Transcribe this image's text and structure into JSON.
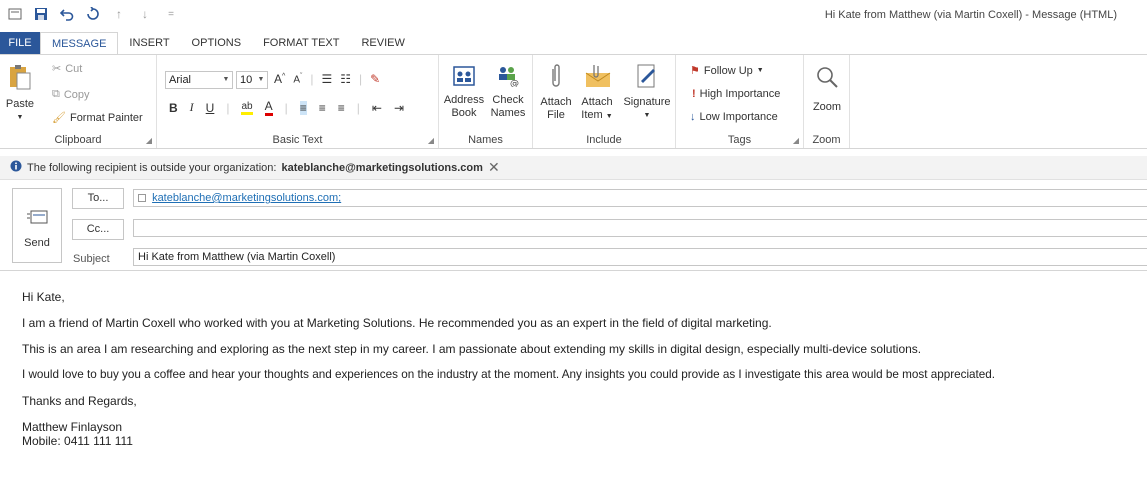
{
  "window": {
    "title": "Hi Kate from Matthew (via Martin Coxell) - Message (HTML)"
  },
  "tabs": [
    {
      "label": "FILE"
    },
    {
      "label": "MESSAGE"
    },
    {
      "label": "INSERT"
    },
    {
      "label": "OPTIONS"
    },
    {
      "label": "FORMAT TEXT"
    },
    {
      "label": "REVIEW"
    }
  ],
  "ribbon": {
    "clipboard": {
      "label": "Clipboard",
      "paste": "Paste",
      "cut": "Cut",
      "copy": "Copy",
      "format_painter": "Format Painter"
    },
    "basic_text": {
      "label": "Basic Text",
      "font": "Arial",
      "size": "10"
    },
    "names": {
      "label": "Names",
      "address_book_1": "Address",
      "address_book_2": "Book",
      "check_names_1": "Check",
      "check_names_2": "Names"
    },
    "include": {
      "label": "Include",
      "attach_file_1": "Attach",
      "attach_file_2": "File",
      "attach_item_1": "Attach",
      "attach_item_2": "Item",
      "signature": "Signature"
    },
    "tags": {
      "label": "Tags",
      "follow_up": "Follow Up",
      "high": "High Importance",
      "low": "Low Importance"
    },
    "zoom": {
      "label": "Zoom",
      "zoom": "Zoom"
    }
  },
  "infobar": {
    "text": "The following recipient is outside your organization:",
    "email": "kateblanche@marketingsolutions.com"
  },
  "header": {
    "send": "Send",
    "to_button": "To...",
    "cc_button": "Cc...",
    "subject_label": "Subject",
    "to_value": "kateblanche@marketingsolutions.com;",
    "cc_value": "",
    "subject_value": "Hi Kate from Matthew (via Martin Coxell)"
  },
  "body": {
    "greeting": "Hi Kate,",
    "p1": "I am a friend of Martin Coxell who worked with you at Marketing Solutions.  He recommended you as an expert in the field of digital marketing.",
    "p2": "This is an area I am researching and exploring as the next step in my career.  I am passionate about extending my skills in digital design, especially multi-device solutions.",
    "p3": "I would love to buy you a coffee and hear your thoughts and experiences on the industry at the moment.  Any insights you could provide as I investigate this area would be most appreciated.",
    "closing": "Thanks and Regards,",
    "name": "Matthew Finlayson",
    "mobile": "Mobile: 0411 111 111"
  },
  "colors": {
    "accent": "#2b579a",
    "flag": "#c0392b",
    "link": "#1f6fb5"
  }
}
